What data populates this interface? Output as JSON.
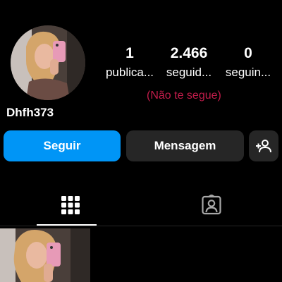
{
  "profile": {
    "username": "Dhfh373",
    "follow_note": "(Não te segue)"
  },
  "stats": {
    "posts": {
      "value": "1",
      "label": "publica..."
    },
    "followers": {
      "value": "2.466",
      "label": "seguid..."
    },
    "following": {
      "value": "0",
      "label": "seguin..."
    }
  },
  "actions": {
    "follow_label": "Seguir",
    "message_label": "Mensagem",
    "suggest_icon": "add-person-icon"
  },
  "tabs": {
    "grid_icon": "grid-icon",
    "tagged_icon": "tagged-icon"
  },
  "colors": {
    "background": "#000000",
    "accent": "#0095f6",
    "secondary_button": "#262626",
    "follow_note": "#c11c4a"
  }
}
